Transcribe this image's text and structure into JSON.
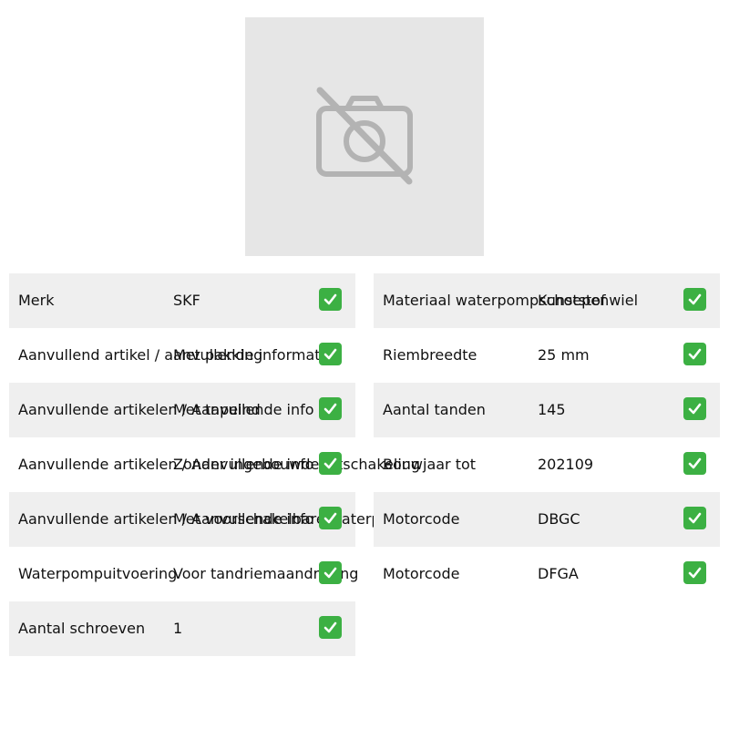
{
  "image_placeholder": {
    "icon": "no-photo-icon"
  },
  "left_table": {
    "rows": [
      {
        "label": "Merk",
        "value": "SKF"
      },
      {
        "label": "Aanvullend artikel / aanvullende informatie",
        "value": "Met pakking"
      },
      {
        "label": "Aanvullende artikelen / Aanvullende info 2",
        "value": "Met tapeind"
      },
      {
        "label": "Aanvullende artikelen / Aanvullende info 2",
        "value": "Zonder ingebouwde uitschakeling"
      },
      {
        "label": "Aanvullende artikelen / Aanvullende info 2",
        "value": "Met voorschakelbare waterpomp"
      },
      {
        "label": "Waterpompuitvoering",
        "value": "Voor tandriemaandrijving"
      },
      {
        "label": "Aantal schroeven",
        "value": "1"
      }
    ]
  },
  "right_table": {
    "rows": [
      {
        "label": "Materiaal waterpompschoepenwiel",
        "value": "Kunststof"
      },
      {
        "label": "Riembreedte",
        "value": "25 mm"
      },
      {
        "label": "Aantal tanden",
        "value": "145"
      },
      {
        "label": "Bouwjaar tot",
        "value": "202109"
      },
      {
        "label": "Motorcode",
        "value": "DBGC"
      },
      {
        "label": "Motorcode",
        "value": "DFGA"
      }
    ]
  },
  "check_icon": "check-mark-icon",
  "colors": {
    "row_shade": "#efefef",
    "check_green": "#3cb043",
    "placeholder_bg": "#e6e6e6",
    "placeholder_icon": "#b3b3b3"
  }
}
